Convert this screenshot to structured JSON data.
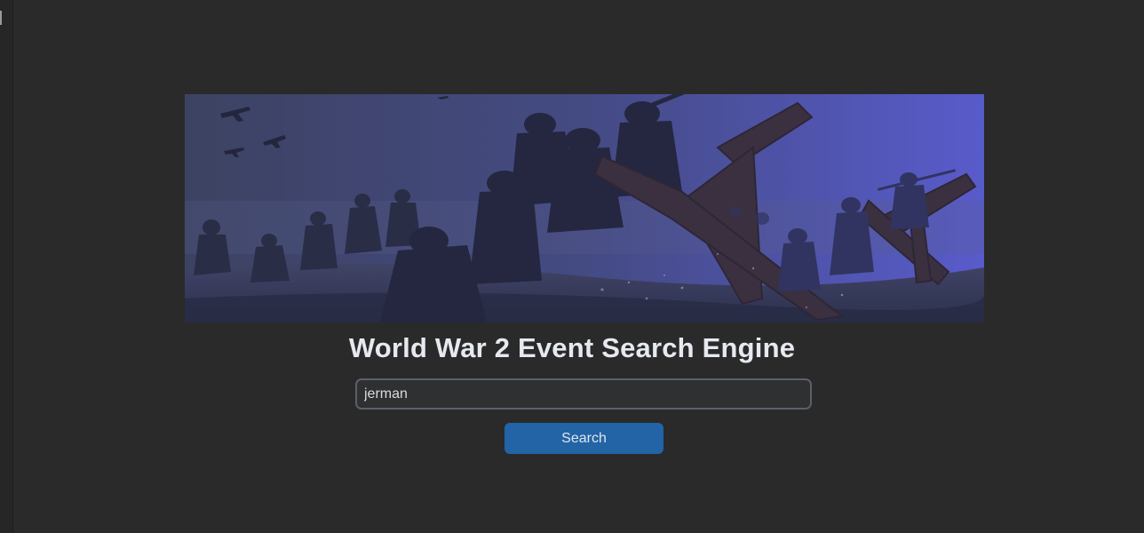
{
  "header": {
    "title": "World War 2 Event Search Engine"
  },
  "search": {
    "value": "jerman",
    "button_label": "Search"
  },
  "banner": {
    "scene": "ww2-beach-landing-soldiers-illustration"
  },
  "colors": {
    "background": "#2a2a2a",
    "button": "#2264a6",
    "title_text": "#e6e9f0",
    "input_border": "#5b6068"
  }
}
